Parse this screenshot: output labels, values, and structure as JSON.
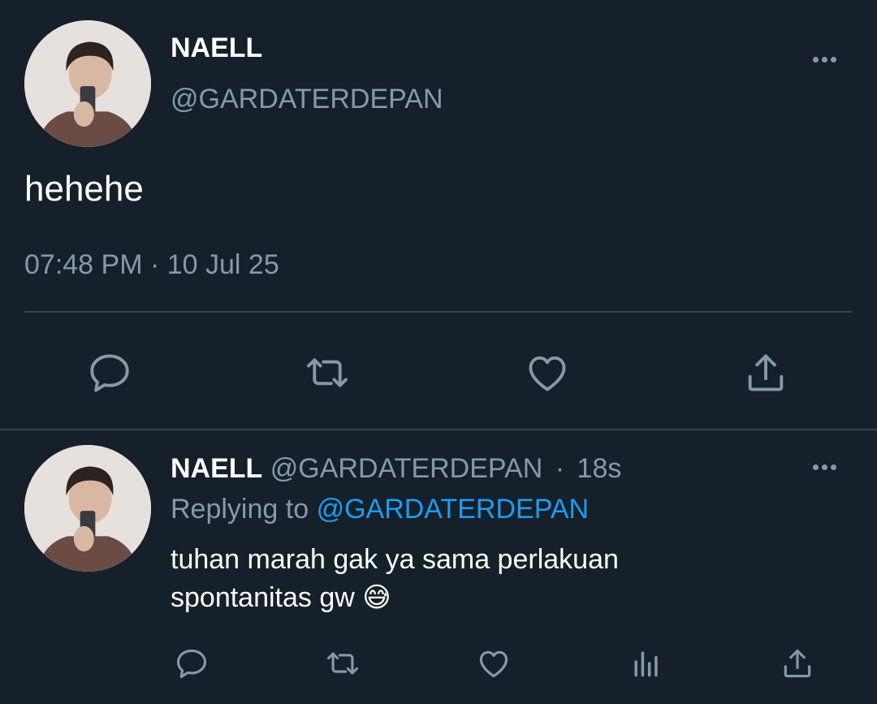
{
  "main_tweet": {
    "author_name": "NAELL",
    "handle": "@GARDATERDEPAN",
    "text": "hehehe",
    "timestamp": "07:48 PM · 10 Jul 25",
    "actions": [
      "reply-icon",
      "retweet-icon",
      "like-icon",
      "share-icon"
    ]
  },
  "reply_tweet": {
    "author_name": "NAELL",
    "handle": "@GARDATERDEPAN",
    "separator": "·",
    "age": "18s",
    "replying_prefix": "Replying to",
    "replying_handle": "@GARDATERDEPAN",
    "text_line1": "tuhan marah gak ya sama perlakuan",
    "text_line2": "spontanitas gw",
    "emoji": "😅",
    "actions": [
      "reply-icon",
      "retweet-icon",
      "like-icon",
      "analytics-icon",
      "share-icon"
    ]
  },
  "colors": {
    "background": "#15202b",
    "muted_text": "#8899a6",
    "link": "#1d9bf0",
    "divider": "#38444d"
  }
}
